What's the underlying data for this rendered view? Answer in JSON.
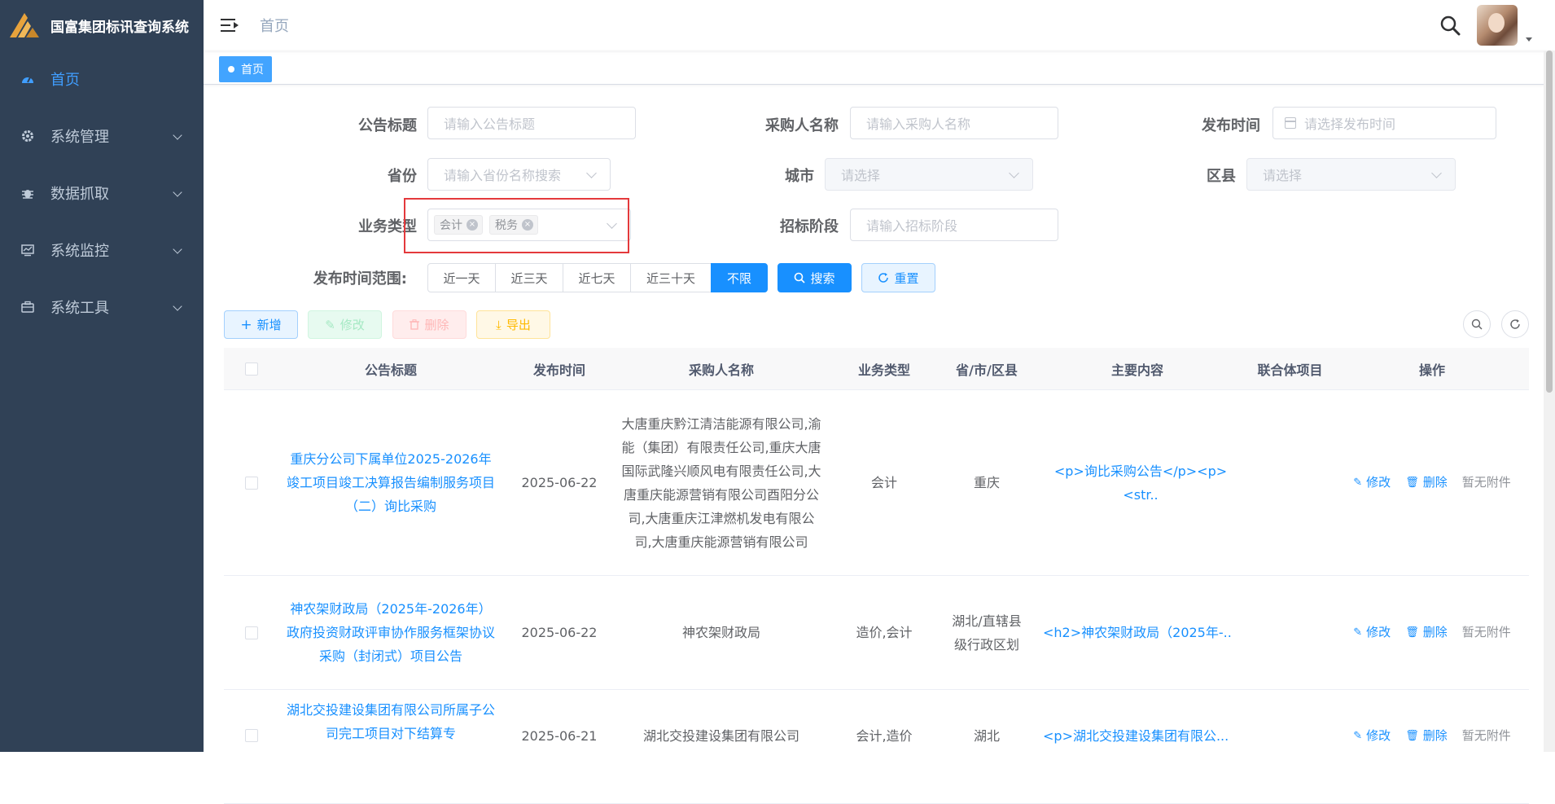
{
  "app": {
    "title": "国富集团标讯查询系统"
  },
  "sidebar": {
    "items": [
      {
        "label": "首页",
        "icon": "dashboard-icon",
        "active": true
      },
      {
        "label": "系统管理",
        "icon": "gear-icon"
      },
      {
        "label": "数据抓取",
        "icon": "bug-icon"
      },
      {
        "label": "系统监控",
        "icon": "monitor-icon"
      },
      {
        "label": "系统工具",
        "icon": "toolbox-icon"
      }
    ]
  },
  "header": {
    "breadcrumb": "首页"
  },
  "tags_view": {
    "active_tag": "首页"
  },
  "filters": {
    "title": {
      "label": "公告标题",
      "placeholder": "请输入公告标题"
    },
    "purchaser": {
      "label": "采购人名称",
      "placeholder": "请输入采购人名称"
    },
    "publish_time": {
      "label": "发布时间",
      "placeholder": "请选择发布时间"
    },
    "province": {
      "label": "省份",
      "placeholder": "请输入省份名称搜索"
    },
    "city": {
      "label": "城市",
      "placeholder": "请选择"
    },
    "district": {
      "label": "区县",
      "placeholder": "请选择"
    },
    "business_type": {
      "label": "业务类型",
      "selected": [
        "会计",
        "税务"
      ]
    },
    "bid_stage": {
      "label": "招标阶段",
      "placeholder": "请输入招标阶段"
    },
    "time_range": {
      "label": "发布时间范围:",
      "options": [
        "近一天",
        "近三天",
        "近七天",
        "近三十天",
        "不限"
      ],
      "selected": "不限"
    },
    "search_label": "搜索",
    "reset_label": "重置"
  },
  "toolbar": {
    "add": "新增",
    "edit": "修改",
    "delete": "删除",
    "export": "导出"
  },
  "table": {
    "columns": [
      "公告标题",
      "发布时间",
      "采购人名称",
      "业务类型",
      "省/市/区县",
      "主要内容",
      "联合体项目",
      "操作"
    ],
    "rows": [
      {
        "title": "重庆分公司下属单位2025-2026年竣工项目竣工决算报告编制服务项目（二）询比采购",
        "date": "2025-06-22",
        "purchaser": "大唐重庆黔江清洁能源有限公司,渝能（集团）有限责任公司,重庆大唐国际武隆兴顺风电有限责任公司,大唐重庆能源营销有限公司酉阳分公司,大唐重庆江津燃机发电有限公司,大唐重庆能源营销有限公司",
        "biz_type": "会计",
        "region": "重庆",
        "content": "<p>询比采购公告</p><p><str..",
        "consortium": ""
      },
      {
        "title": "神农架财政局（2025年-2026年）政府投资财政评审协作服务框架协议采购（封闭式）项目公告",
        "date": "2025-06-22",
        "purchaser": "神农架财政局",
        "biz_type": "造价,会计",
        "region": "湖北/直辖县级行政区划",
        "content": "<h2>神农架财政局（2025年-..",
        "consortium": ""
      },
      {
        "title": "湖北交投建设集团有限公司所属子公司完工项目对下结算专",
        "date": "2025-06-21",
        "purchaser": "湖北交投建设集团有限公司",
        "biz_type": "会计,造价",
        "region": "湖北",
        "content": "<p>湖北交投建设集团有限公...",
        "consortium": ""
      }
    ],
    "actions": {
      "edit": "修改",
      "delete": "删除",
      "attachment": "暂无附件"
    }
  },
  "colors": {
    "sidebar_bg": "#304156",
    "primary": "#1890ff",
    "highlight": "#e4393c"
  }
}
